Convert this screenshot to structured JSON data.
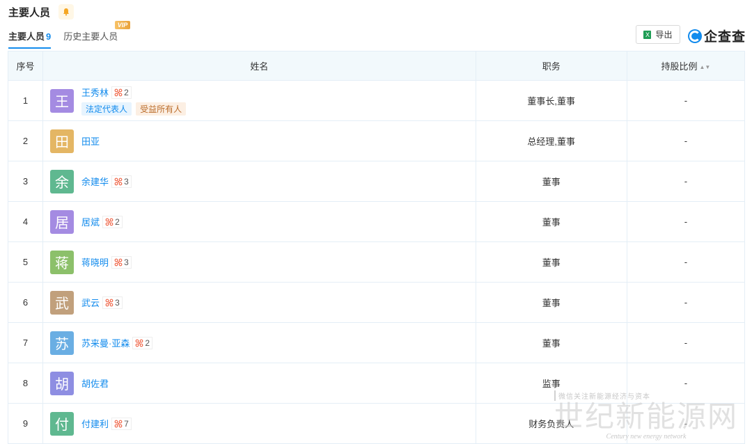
{
  "header": {
    "title": "主要人员",
    "bell_icon": "bell-icon"
  },
  "tabs": [
    {
      "label": "主要人员",
      "count": "9"
    },
    {
      "label": "历史主要人员",
      "badge": "VIP"
    }
  ],
  "toolbar": {
    "export_label": "导出",
    "brand_name": "企查查"
  },
  "table": {
    "columns": [
      "序号",
      "姓名",
      "职务",
      "持股比例"
    ],
    "rows": [
      {
        "idx": "1",
        "avatar": "王",
        "avatar_color": "#a48be2",
        "name": "王秀林",
        "related": "2",
        "role": "董事长,董事",
        "share": "-",
        "tags": [
          "法定代表人",
          "受益所有人"
        ]
      },
      {
        "idx": "2",
        "avatar": "田",
        "avatar_color": "#e4b664",
        "name": "田亚",
        "related": "",
        "role": "总经理,董事",
        "share": "-"
      },
      {
        "idx": "3",
        "avatar": "余",
        "avatar_color": "#5fb890",
        "name": "余建华",
        "related": "3",
        "role": "董事",
        "share": "-"
      },
      {
        "idx": "4",
        "avatar": "居",
        "avatar_color": "#a48be2",
        "name": "居斌",
        "related": "2",
        "role": "董事",
        "share": "-"
      },
      {
        "idx": "5",
        "avatar": "蒋",
        "avatar_color": "#8cc06a",
        "name": "蒋晓明",
        "related": "3",
        "role": "董事",
        "share": "-"
      },
      {
        "idx": "6",
        "avatar": "武",
        "avatar_color": "#c1a07c",
        "name": "武云",
        "related": "3",
        "role": "董事",
        "share": "-"
      },
      {
        "idx": "7",
        "avatar": "苏",
        "avatar_color": "#6aaee3",
        "name": "苏来曼·亚森",
        "related": "2",
        "role": "董事",
        "share": "-"
      },
      {
        "idx": "8",
        "avatar": "胡",
        "avatar_color": "#8e8ee2",
        "name": "胡佐君",
        "related": "",
        "role": "监事",
        "share": "-"
      },
      {
        "idx": "9",
        "avatar": "付",
        "avatar_color": "#5fb890",
        "name": "付建利",
        "related": "7",
        "role": "财务负责人",
        "share": "-"
      }
    ]
  },
  "watermark": {
    "small": "微信关注新能源经济与资本",
    "big": "世纪新能源网",
    "english": "Century new energy network"
  }
}
